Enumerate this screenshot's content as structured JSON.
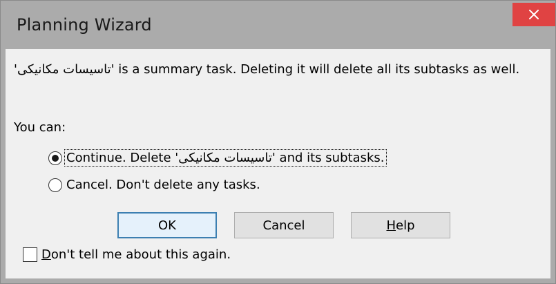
{
  "window": {
    "title": "Planning Wizard"
  },
  "message": {
    "task_name": "'تاسیسات مکانیکی'",
    "text": " is a summary task.  Deleting it will delete all its subtasks as well."
  },
  "options": {
    "heading": "You can:",
    "continue": {
      "prefix": "Continue.  Delete ",
      "task_name": "'تاسیسات مکانیکی'",
      "suffix": " and its subtasks.",
      "selected": true
    },
    "cancel": {
      "label": "Cancel.  Don't delete any tasks.",
      "selected": false
    }
  },
  "buttons": {
    "ok": "OK",
    "cancel": "Cancel",
    "help_mnemonic": "H",
    "help_rest": "elp"
  },
  "checkbox": {
    "mnemonic": "D",
    "rest": "on't tell me about this again.",
    "checked": false
  },
  "colors": {
    "titlebar": "#ababab",
    "close_button": "#e04343",
    "client_background": "#f0f0f0",
    "default_button_border": "#3c7fb1"
  },
  "icons": {
    "close": "close-icon"
  }
}
